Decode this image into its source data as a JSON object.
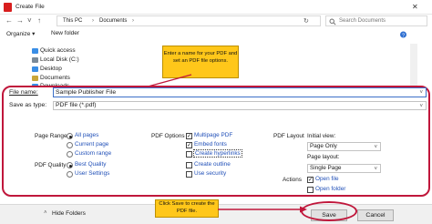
{
  "window": {
    "title": "Create File",
    "close_glyph": "✕"
  },
  "nav": {
    "back_glyph": "←",
    "forward_glyph": "→",
    "dropdown_glyph": "˅",
    "up_glyph": "↑",
    "breadcrumb": [
      "This PC",
      "Documents"
    ],
    "breadcrumb_sep": "›",
    "refresh_glyph": "↻",
    "search_placeholder": "Search Documents"
  },
  "toolbar": {
    "organize": "Organize ▾",
    "new_folder": "New folder"
  },
  "sidebar": {
    "items": [
      {
        "label": "Quick access",
        "icon": "star-icon",
        "color": "#3a8ee6"
      },
      {
        "label": "Local Disk (C:)",
        "icon": "drive-icon",
        "color": "#7a8a99"
      },
      {
        "label": "Desktop",
        "icon": "desktop-icon",
        "color": "#3a8ee6"
      },
      {
        "label": "Documents",
        "icon": "documents-icon",
        "color": "#c9a63a"
      },
      {
        "label": "Downloads",
        "icon": "download-icon",
        "color": "#3a8ee6"
      }
    ]
  },
  "callouts": {
    "top": "Enter a name for your PDF and set an PDF file options.",
    "bottom": "Click Save to create the PDF file."
  },
  "form": {
    "file_name_label": "File name:",
    "file_name_value": "Sample Publisher File",
    "save_type_label": "Save as type:",
    "save_type_value": "PDF file (*.pdf)"
  },
  "options": {
    "page_range_label": "Page Range",
    "page_range": [
      {
        "label": "All pages",
        "checked": true
      },
      {
        "label": "Current page",
        "checked": false
      },
      {
        "label": "Custom range",
        "checked": false
      }
    ],
    "pdf_quality_label": "PDF Quality",
    "pdf_quality": [
      {
        "label": "Best Quality",
        "checked": true
      },
      {
        "label": "User Settings",
        "checked": false
      }
    ],
    "pdf_options_label": "PDF Options",
    "pdf_options": [
      {
        "label": "Multipage PDF",
        "checked": true
      },
      {
        "label": "Embed fonts",
        "checked": true
      },
      {
        "label": "Create hyperlinks",
        "checked": false
      },
      {
        "label": "Create outline",
        "checked": false
      },
      {
        "label": "Use security",
        "checked": false
      }
    ],
    "pdf_layout_label": "PDF Layout",
    "initial_view_label": "Initial view:",
    "initial_view_value": "Page Only",
    "page_layout_label": "Page layout:",
    "page_layout_value": "Single Page",
    "actions_label": "Actions",
    "actions": [
      {
        "label": "Open file",
        "checked": true
      },
      {
        "label": "Open folder",
        "checked": false
      }
    ]
  },
  "footer": {
    "hide_folders": "Hide Folders",
    "save": "Save",
    "cancel": "Cancel"
  },
  "colors": {
    "accent_red": "#c0173b",
    "callout_yellow": "#ffc71a",
    "link_blue": "#2150b8"
  }
}
